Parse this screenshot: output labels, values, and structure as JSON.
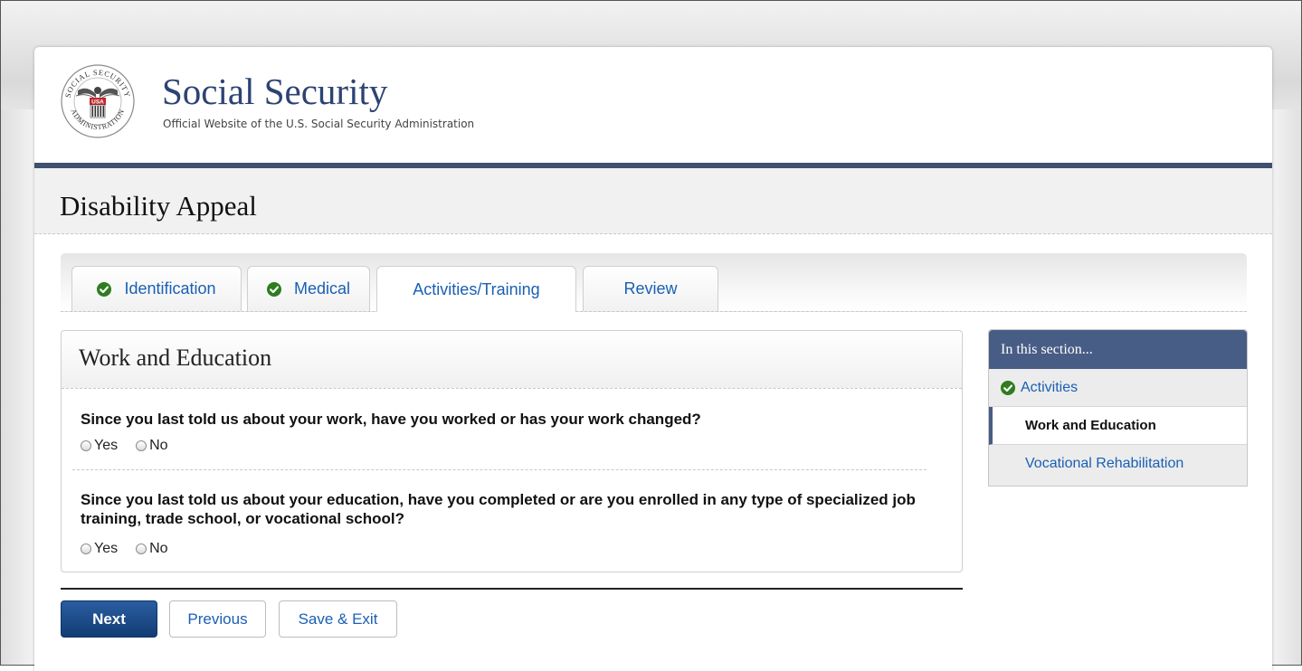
{
  "header": {
    "title": "Social Security",
    "subtitle": "Official Website of the U.S. Social Security Administration",
    "seal_text": {
      "ring_top": "SOCIAL SECURITY",
      "ring_bottom": "ADMINISTRATION",
      "badge": "USA"
    }
  },
  "page": {
    "title": "Disability Appeal"
  },
  "tabs": [
    {
      "label": "Identification",
      "completed": true
    },
    {
      "label": "Medical",
      "completed": true
    },
    {
      "label": "Activities/Training",
      "active": true
    },
    {
      "label": "Review"
    }
  ],
  "form": {
    "title": "Work and Education",
    "questions": [
      {
        "text": "Since you last told us about your work, have you worked or has your work changed?",
        "options": [
          "Yes",
          "No"
        ]
      },
      {
        "text": "Since you last told us about your education, have you completed or are you enrolled in any type of specialized job training, trade school, or vocational school?",
        "options": [
          "Yes",
          "No"
        ]
      }
    ]
  },
  "buttons": {
    "next": "Next",
    "previous": "Previous",
    "save_exit": "Save & Exit"
  },
  "sidebar": {
    "heading": "In this section...",
    "items": [
      {
        "label": "Activities",
        "status": "completed"
      },
      {
        "label": "Work and Education",
        "status": "current"
      },
      {
        "label": "Vocational Rehabilitation",
        "status": "upcoming"
      }
    ]
  },
  "colors": {
    "brand_navy": "#2d4373",
    "link_blue": "#1a5fb4",
    "check_green": "#2e7d1f",
    "sidebar_head": "#485d86"
  }
}
